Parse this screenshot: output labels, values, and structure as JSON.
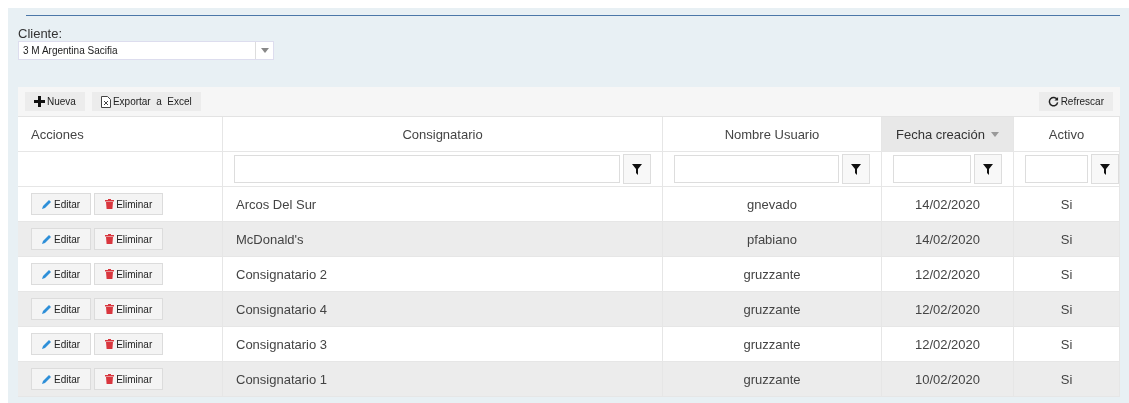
{
  "client": {
    "label": "Cliente:",
    "value": "3 M Argentina Sacifia"
  },
  "toolbar": {
    "new": "Nueva",
    "export": "Exportar  a  Excel",
    "refresh": "Refrescar"
  },
  "table": {
    "columns": [
      {
        "label": "Acciones",
        "sorted": false,
        "filter": false
      },
      {
        "label": "Consignatario",
        "sorted": false,
        "filter": true
      },
      {
        "label": "Nombre Usuario",
        "sorted": false,
        "filter": true
      },
      {
        "label": "Fecha creación",
        "sorted": true,
        "filter": true
      },
      {
        "label": "Activo",
        "sorted": false,
        "filter": true
      }
    ],
    "rows": [
      {
        "edit": "Editar",
        "delete": "Eliminar",
        "consignee": "Arcos Del Sur",
        "user": "gnevado",
        "date": "14/02/2020",
        "active": "Si"
      },
      {
        "edit": "Editar",
        "delete": "Eliminar",
        "consignee": "McDonald's",
        "user": "pfabiano",
        "date": "14/02/2020",
        "active": "Si"
      },
      {
        "edit": "Editar",
        "delete": "Eliminar",
        "consignee": "Consignatario 2",
        "user": "gruzzante",
        "date": "12/02/2020",
        "active": "Si"
      },
      {
        "edit": "Editar",
        "delete": "Eliminar",
        "consignee": "Consignatario 4",
        "user": "gruzzante",
        "date": "12/02/2020",
        "active": "Si"
      },
      {
        "edit": "Editar",
        "delete": "Eliminar",
        "consignee": "Consignatario 3",
        "user": "gruzzante",
        "date": "12/02/2020",
        "active": "Si"
      },
      {
        "edit": "Editar",
        "delete": "Eliminar",
        "consignee": "Consignatario 1",
        "user": "gruzzante",
        "date": "10/02/2020",
        "active": "Si"
      }
    ]
  }
}
